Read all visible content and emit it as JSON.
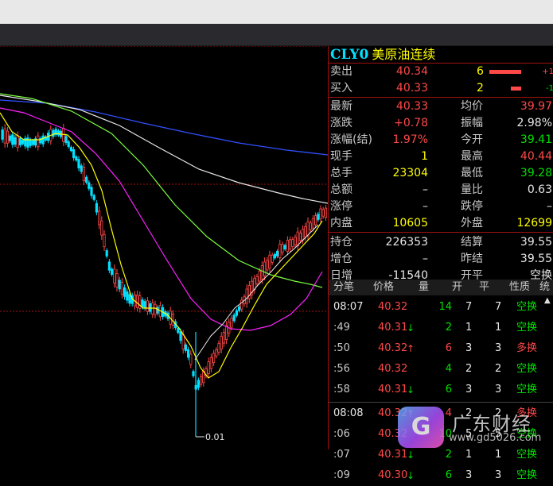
{
  "header": {
    "code": "CLY0",
    "name": "美原油连续"
  },
  "colors": {
    "up": "#ff4848",
    "down": "#00e000",
    "bid_ask_bar": "#ff4848",
    "ma_white": "#e8e8e8",
    "ma_yellow": "#ffff00",
    "ma_magenta": "#ff20ff",
    "ma_green": "#7cff40",
    "ma_blue": "#3050ff",
    "candle_up": "#ff4848",
    "candle_down": "#00e0ff"
  },
  "orderbook": {
    "sell": {
      "label": "卖出",
      "price": "40.34",
      "qty": "6",
      "delta": "+1"
    },
    "buy": {
      "label": "买入",
      "price": "40.33",
      "qty": "2",
      "delta": "-1"
    }
  },
  "stats": [
    {
      "l1": "最新",
      "v1": "40.33",
      "c1": "red",
      "l2": "均价",
      "v2": "39.97",
      "c2": "red"
    },
    {
      "l1": "涨跌",
      "v1": "+0.78",
      "c1": "red",
      "l2": "振幅",
      "v2": "2.98%",
      "c2": "white"
    },
    {
      "l1": "涨幅(结)",
      "v1": "1.97%",
      "c1": "red",
      "l2": "今开",
      "v2": "39.41",
      "c2": "green"
    },
    {
      "l1": "现手",
      "v1": "1",
      "c1": "yellow",
      "l2": "最高",
      "v2": "40.44",
      "c2": "red"
    },
    {
      "l1": "总手",
      "v1": "23304",
      "c1": "yellow",
      "l2": "最低",
      "v2": "39.28",
      "c2": "green"
    },
    {
      "l1": "总额",
      "v1": "–",
      "c1": "white",
      "l2": "量比",
      "v2": "0.63",
      "c2": "white"
    },
    {
      "l1": "涨停",
      "v1": "–",
      "c1": "white",
      "l2": "跌停",
      "v2": "–",
      "c2": "white"
    },
    {
      "l1": "内盘",
      "v1": "10605",
      "c1": "yellow",
      "l2": "外盘",
      "v2": "12699",
      "c2": "yellow"
    },
    {
      "l1": "持仓",
      "v1": "226353",
      "c1": "white",
      "l2": "结算",
      "v2": "39.55",
      "c2": "white"
    },
    {
      "l1": "增仓",
      "v1": "–",
      "c1": "white",
      "l2": "昨结",
      "v2": "39.55",
      "c2": "white"
    },
    {
      "l1": "日增",
      "v1": "-11540",
      "c1": "white",
      "l2": "开平",
      "v2": "空换",
      "c2": "white"
    }
  ],
  "ticks_header": {
    "c0": "分笔",
    "c1": "价格",
    "c2": "量",
    "c3": "开",
    "c4": "平",
    "c5": "性质",
    "c6": "统"
  },
  "ticks": [
    {
      "time": "08:07",
      "price": "40.32",
      "arrow": "",
      "qty": "14",
      "open": "7",
      "close": "7",
      "type": "空换",
      "type_color": "green",
      "qty_color": "green"
    },
    {
      "time": ":49",
      "price": "40.31",
      "arrow": "↓",
      "qty": "2",
      "open": "1",
      "close": "1",
      "type": "空换",
      "type_color": "green",
      "qty_color": "green"
    },
    {
      "time": ":50",
      "price": "40.32",
      "arrow": "↑",
      "qty": "6",
      "open": "3",
      "close": "3",
      "type": "多换",
      "type_color": "red",
      "qty_color": "red"
    },
    {
      "time": ":56",
      "price": "40.32",
      "arrow": "",
      "qty": "4",
      "open": "2",
      "close": "2",
      "type": "空换",
      "type_color": "green",
      "qty_color": "green"
    },
    {
      "time": ":58",
      "price": "40.31",
      "arrow": "↓",
      "qty": "6",
      "open": "3",
      "close": "3",
      "type": "空换",
      "type_color": "green",
      "qty_color": "green"
    },
    {
      "time": "08:08",
      "price": "40.32",
      "arrow": "↑",
      "qty": "4",
      "open": "2",
      "close": "2",
      "type": "多换",
      "type_color": "red",
      "qty_color": "red"
    },
    {
      "time": ":06",
      "price": "40.32",
      "arrow": "",
      "qty": "10",
      "open": "5",
      "close": "5",
      "type": "空换",
      "type_color": "green",
      "qty_color": "green"
    },
    {
      "time": ":07",
      "price": "40.31",
      "arrow": "↓",
      "qty": "2",
      "open": "1",
      "close": "1",
      "type": "空换",
      "type_color": "green",
      "qty_color": "green"
    },
    {
      "time": ":09",
      "price": "40.30",
      "arrow": "↓",
      "qty": "6",
      "open": "3",
      "close": "3",
      "type": "空换",
      "type_color": "green",
      "qty_color": "green"
    }
  ],
  "chart_label": "0.01",
  "watermark": {
    "logo": "G",
    "text": "广东财经",
    "url": "www.gd5026.com"
  }
}
